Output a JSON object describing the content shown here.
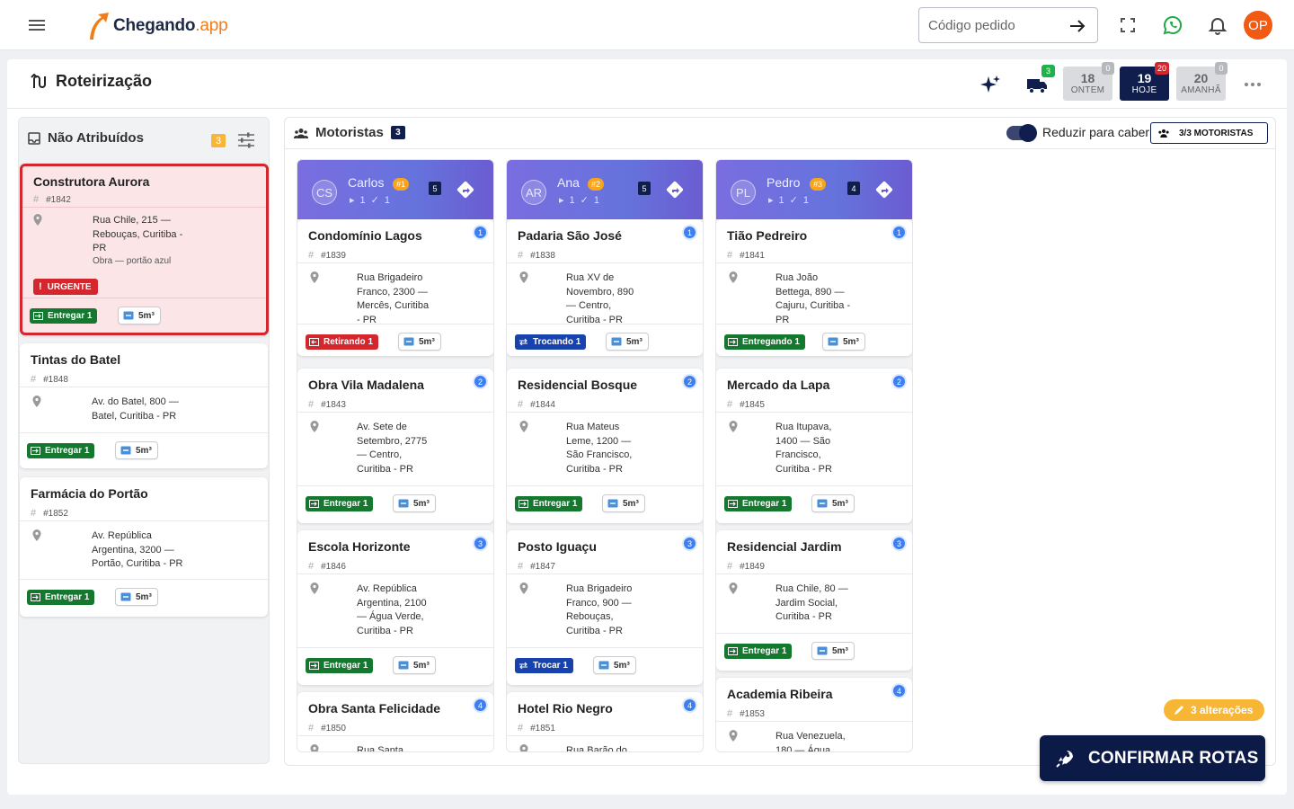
{
  "header": {
    "logo_name": "Chegando",
    "logo_suffix": ".app",
    "search_placeholder": "Código pedido",
    "avatar_initials": "OP"
  },
  "page": {
    "title": "Roteirização",
    "trucks_badge": "3",
    "days": [
      {
        "number": "18",
        "label": "ONTEM",
        "badge": "0"
      },
      {
        "number": "19",
        "label": "HOJE",
        "badge": "20"
      },
      {
        "number": "20",
        "label": "AMANHÃ",
        "badge": "0"
      }
    ]
  },
  "unassigned": {
    "title": "Não Atribuídos",
    "count": "3",
    "cards": [
      {
        "name": "Construtora Aurora",
        "code": "#1842",
        "address": "Rua Chile, 215 — Rebouças, Curitiba - PR",
        "note": "Obra — portão azul",
        "urgent": "URGENTE",
        "action": "Entregar 1",
        "volume": "5m³"
      },
      {
        "name": "Tintas do Batel",
        "code": "#1848",
        "address": "Av. do Batel, 800 — Batel, Curitiba - PR",
        "action": "Entregar 1",
        "volume": "5m³"
      },
      {
        "name": "Farmácia do Portão",
        "code": "#1852",
        "address": "Av. República Argentina, 3200 — Portão, Curitiba - PR",
        "action": "Entregar 1",
        "volume": "5m³"
      }
    ]
  },
  "drivers_section": {
    "title": "Motoristas",
    "count": "3",
    "reduce_label": "Reduzir para caber",
    "drivers_button": "3/3 MOTORISTAS"
  },
  "drivers": [
    {
      "initials": "CS",
      "name": "Carlos",
      "number": "#1",
      "stat1": "1",
      "stat2": "1",
      "count": "5",
      "stops": [
        {
          "seq": "1",
          "name": "Condomínio Lagos",
          "code": "#1839",
          "address": "Rua Brigadeiro Franco, 2300 — Mercês, Curitiba - PR",
          "action": "Retirando 1",
          "volume": "5m³"
        },
        {
          "seq": "2",
          "name": "Obra Vila Madalena",
          "code": "#1843",
          "address": "Av. Sete de Setembro, 2775 — Centro, Curitiba - PR",
          "action": "Entregar 1",
          "volume": "5m³"
        },
        {
          "seq": "3",
          "name": "Escola Horizonte",
          "code": "#1846",
          "address": "Av. República Argentina, 2100 — Água Verde, Curitiba - PR",
          "action": "Entregar 1",
          "volume": "5m³"
        },
        {
          "seq": "4",
          "name": "Obra Santa Felicidade",
          "code": "#1850",
          "address": "Rua Santa"
        }
      ]
    },
    {
      "initials": "AR",
      "name": "Ana",
      "number": "#2",
      "stat1": "1",
      "stat2": "1",
      "count": "5",
      "stops": [
        {
          "seq": "1",
          "name": "Padaria São José",
          "code": "#1838",
          "address": "Rua XV de Novembro, 890 — Centro, Curitiba - PR",
          "action": "Trocando 1",
          "volume": "5m³"
        },
        {
          "seq": "2",
          "name": "Residencial Bosque",
          "code": "#1844",
          "address": "Rua Mateus Leme, 1200 — São Francisco, Curitiba - PR",
          "action": "Entregar 1",
          "volume": "5m³"
        },
        {
          "seq": "3",
          "name": "Posto Iguaçu",
          "code": "#1847",
          "address": "Rua Brigadeiro Franco, 900 — Rebouças, Curitiba - PR",
          "action": "Trocar 1",
          "volume": "5m³"
        },
        {
          "seq": "4",
          "name": "Hotel Rio Negro",
          "code": "#1851",
          "address": "Rua Barão do"
        }
      ]
    },
    {
      "initials": "PL",
      "name": "Pedro",
      "number": "#3",
      "stat1": "1",
      "stat2": "1",
      "count": "4",
      "stops": [
        {
          "seq": "1",
          "name": "Tião Pedreiro",
          "code": "#1841",
          "address": "Rua João Bettega, 890 — Cajuru, Curitiba - PR",
          "action": "Entregando 1",
          "volume": "5m³"
        },
        {
          "seq": "2",
          "name": "Mercado da Lapa",
          "code": "#1845",
          "address": "Rua Itupava, 1400 — São Francisco, Curitiba - PR",
          "action": "Entregar 1",
          "volume": "5m³"
        },
        {
          "seq": "3",
          "name": "Residencial Jardim",
          "code": "#1849",
          "address": "Rua Chile, 80 — Jardim Social, Curitiba - PR",
          "action": "Entregar 1",
          "volume": "5m³"
        },
        {
          "seq": "4",
          "name": "Academia Ribeira",
          "code": "#1853",
          "address": "Rua Venezuela, 180 — Água"
        }
      ]
    }
  ],
  "changes_label": "3 alterações",
  "confirm_label": "CONFIRMAR ROTAS"
}
